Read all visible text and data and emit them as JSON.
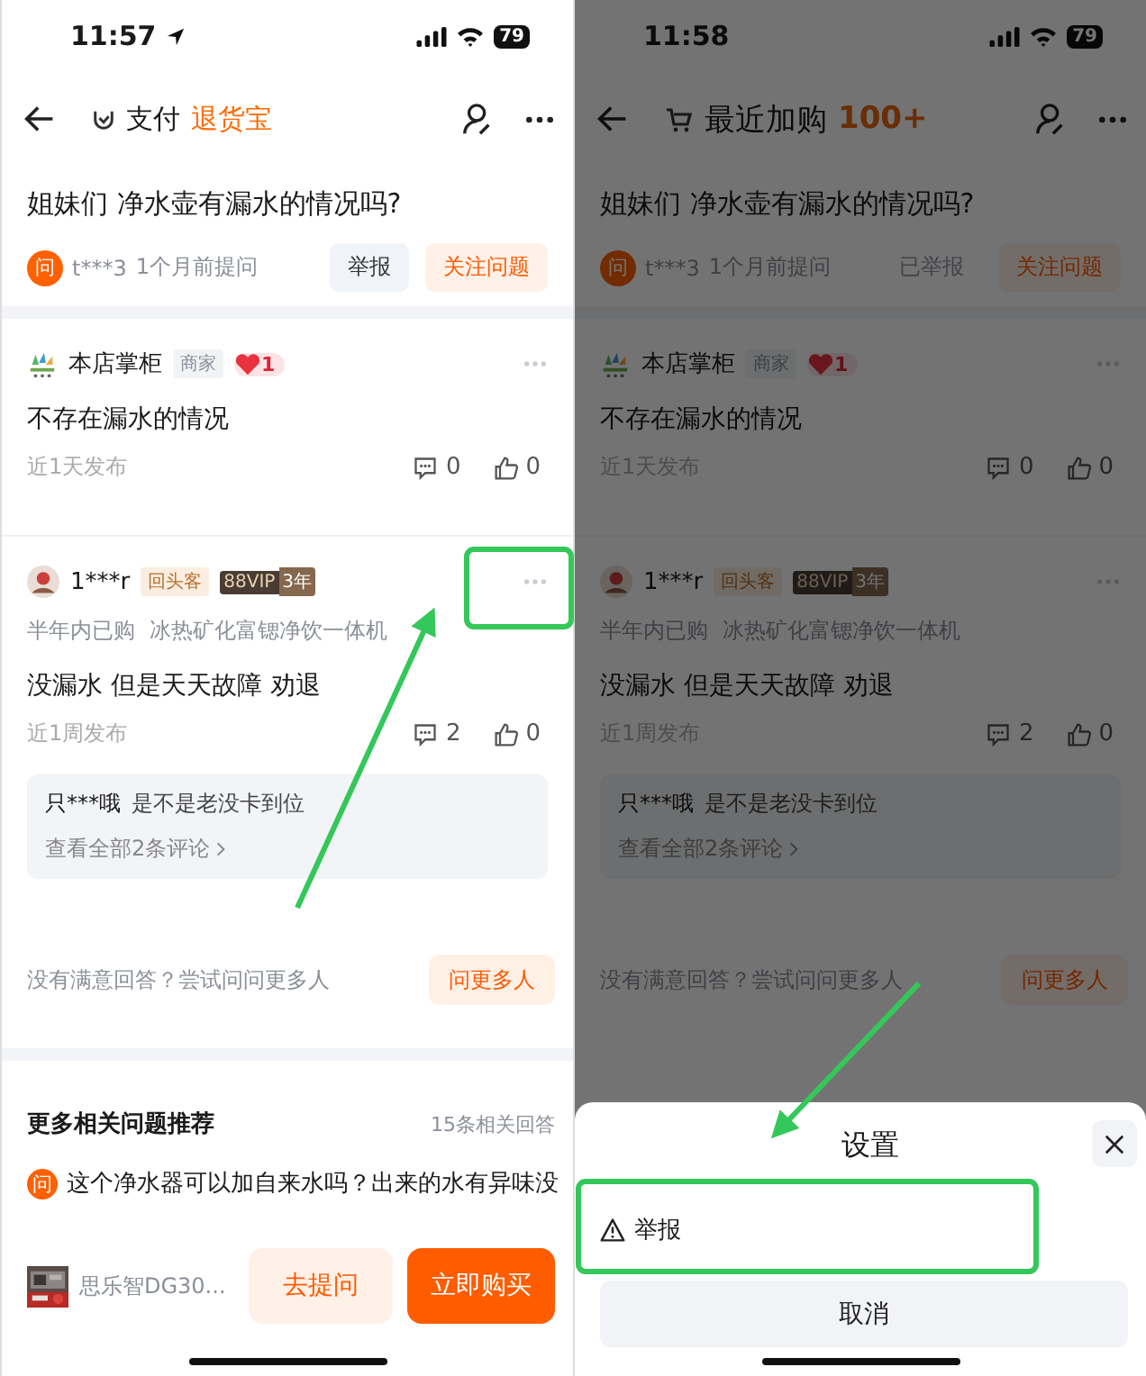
{
  "screens": [
    {
      "status_bar": {
        "time": "11:57",
        "location": true,
        "battery": "79"
      },
      "header": {
        "kind": "ticker",
        "prefix": "支付",
        "highlight": "退货宝"
      },
      "question": {
        "badge": "问",
        "title": "姐妹们 净水壶有漏水的情况吗?",
        "asker": "t***3",
        "time": "1个月前提问",
        "buttons": [
          {
            "label": "举报",
            "kind": "report",
            "disabled": false
          },
          {
            "label": "关注问题",
            "kind": "follow"
          }
        ]
      },
      "answers": [
        {
          "kind": "merchant",
          "name": "本店掌柜",
          "tag": "商家",
          "heart": "1",
          "text": "不存在漏水的情况",
          "time": "近1天发布",
          "comments": "0",
          "likes": "0"
        },
        {
          "kind": "buyer",
          "name": "1***r",
          "tag": "回头客",
          "vip": "88VIP",
          "vip_years": "3年",
          "purchase": "半年内已购",
          "product": "冰热矿化富锶净饮一体机",
          "text": "没漏水 但是天天故障 劝退",
          "time": "近1周发布",
          "comments": "2",
          "likes": "0",
          "reply": {
            "user": "只***哦",
            "text": "是不是老没卡到位"
          },
          "view_all": "查看全部2条评论"
        }
      ],
      "ask_more": {
        "text": "没有满意回答？尝试问问更多人",
        "button": "问更多人"
      },
      "related": {
        "title": "更多相关问题推荐",
        "count": "15条相关回答",
        "items": [
          {
            "badge": "问",
            "text": "这个净水器可以加自来水吗？出来的水有异味没"
          }
        ]
      },
      "bottom_bar": {
        "product": "思乐智DG30...",
        "ask_button": "去提问",
        "buy_button": "立即购买"
      }
    },
    {
      "status_bar": {
        "time": "11:58",
        "location": false,
        "battery": "79"
      },
      "header": {
        "kind": "cart",
        "prefix": "最近加购",
        "highlight": "100+"
      },
      "question": {
        "badge": "问",
        "title": "姐妹们 净水壶有漏水的情况吗?",
        "asker": "t***3",
        "time": "1个月前提问",
        "buttons": [
          {
            "label": "已举报",
            "kind": "report",
            "disabled": true
          },
          {
            "label": "关注问题",
            "kind": "follow"
          }
        ]
      },
      "answers": [
        {
          "kind": "merchant",
          "name": "本店掌柜",
          "tag": "商家",
          "heart": "1",
          "text": "不存在漏水的情况",
          "time": "近1天发布",
          "comments": "0",
          "likes": "0"
        },
        {
          "kind": "buyer",
          "name": "1***r",
          "tag": "回头客",
          "vip": "88VIP",
          "vip_years": "3年",
          "purchase": "半年内已购",
          "product": "冰热矿化富锶净饮一体机",
          "text": "没漏水 但是天天故障 劝退",
          "time": "近1周发布",
          "comments": "2",
          "likes": "0",
          "reply": {
            "user": "只***哦",
            "text": "是不是老没卡到位"
          },
          "view_all": "查看全部2条评论"
        }
      ],
      "ask_more": {
        "text": "没有满意回答？尝试问问更多人",
        "button": "问更多人"
      },
      "sheet": {
        "title": "设置",
        "options": [
          {
            "label": "举报",
            "kind": "report"
          }
        ],
        "cancel": "取消"
      }
    }
  ]
}
